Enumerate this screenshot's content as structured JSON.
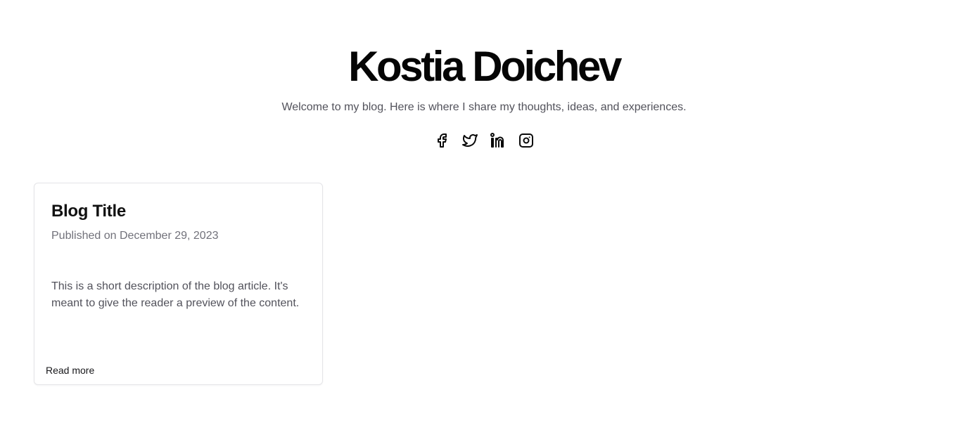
{
  "header": {
    "title": "Kostia Doichev",
    "tagline": "Welcome to my blog. Here is where I share my thoughts, ideas, and experiences."
  },
  "social": [
    {
      "name": "facebook-icon"
    },
    {
      "name": "twitter-icon"
    },
    {
      "name": "linkedin-icon"
    },
    {
      "name": "instagram-icon"
    }
  ],
  "posts": [
    {
      "title": "Blog Title",
      "date": "Published on December 29, 2023",
      "description": "This is a short description of the blog article. It's meant to give the reader a preview of the content.",
      "cta": "Read more"
    }
  ],
  "colors": {
    "text": "#0a0a0a",
    "muted": "#52525b",
    "date": "#71717a",
    "border": "#e4e4e7"
  }
}
